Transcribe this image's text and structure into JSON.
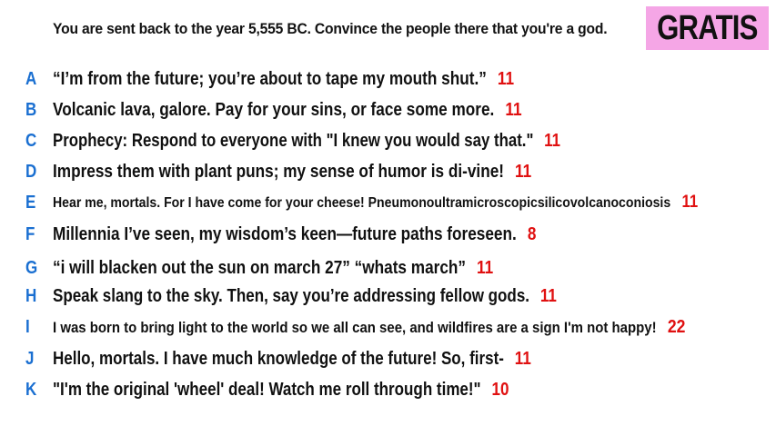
{
  "prompt": "You are sent back to the year 5,555 BC. Convince the people there that you're a god.",
  "badge": "GRATIS",
  "colors": {
    "letter": "#1a6fd1",
    "score": "#e01010",
    "badge_bg": "#f5a6e6"
  },
  "answers": [
    {
      "letter": "A",
      "text": "“I’m from the future; you’re about to tape my mouth shut.”",
      "score": "11"
    },
    {
      "letter": "B",
      "text": "Volcanic lava, galore. Pay for your sins, or face some more.",
      "score": "11"
    },
    {
      "letter": "C",
      "text": "Prophecy: Respond to everyone with \"I knew you would say that.\"",
      "score": "11"
    },
    {
      "letter": "D",
      "text": "Impress them with plant puns; my sense of humor is di-vine!",
      "score": "11"
    },
    {
      "letter": "E",
      "text": "Hear me, mortals. For I have come for your cheese! Pneumonoultramicroscopicsilicovolcanoconiosis",
      "score": "11"
    },
    {
      "letter": "F",
      "text": "Millennia I’ve seen, my wisdom’s keen—future paths foreseen.",
      "score": "8"
    },
    {
      "letter": "G",
      "text": "“i will blacken out the sun on march 27” “whats march”",
      "score": "11"
    },
    {
      "letter": "H",
      "text": "Speak slang to the sky. Then, say you’re addressing fellow gods.",
      "score": "11"
    },
    {
      "letter": "I",
      "text": "I was born to bring light to the world so we all can see, and wildfires are a sign I'm not happy!",
      "score": "22"
    },
    {
      "letter": "J",
      "text": "Hello, mortals. I have much knowledge of the future! So, first-",
      "score": "11"
    },
    {
      "letter": "K",
      "text": "\"I'm the original 'wheel' deal! Watch me roll through time!\"",
      "score": "10"
    }
  ]
}
